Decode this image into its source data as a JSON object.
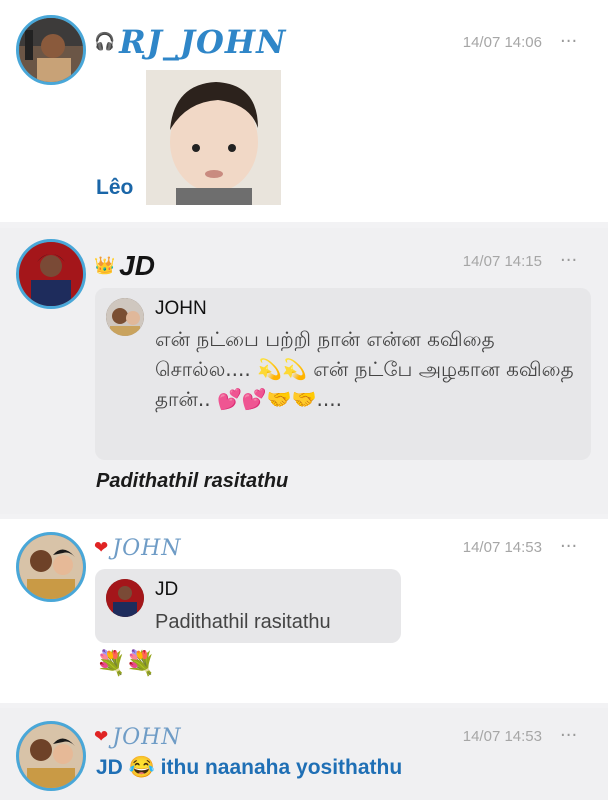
{
  "posts": [
    {
      "username": "RJ_JOHN",
      "badge_icon": "headphones-icon",
      "badge": "🎧",
      "time": "14/07 14:06",
      "more": "···",
      "caption": "Lêo"
    },
    {
      "username": "JD",
      "badge_icon": "crown-icon",
      "badge": "👑",
      "time": "14/07 14:15",
      "more": "···",
      "quote": {
        "name": "JOHN",
        "text": "என் நட்பை பற்றி நான் என்ன கவிதை சொல்ல.... 💫💫 என் நட்பே அழகான கவிதை தான்.. 💕💕🤝🤝...."
      },
      "caption": "Padithathil rasitathu"
    },
    {
      "username": "JOHN",
      "badge_icon": "heart-icon",
      "badge": "❤",
      "time": "14/07 14:53",
      "more": "···",
      "quote": {
        "name": "JD",
        "text": "Padithathil rasitathu"
      },
      "emojis": "💐💐"
    },
    {
      "username": "JOHN",
      "badge_icon": "heart-icon",
      "badge": "❤",
      "time": "14/07 14:53",
      "more": "···",
      "caption": "JD 😂 ithu naanaha yosithathu"
    }
  ],
  "colors": {
    "accent_blue": "#49a7d8",
    "username_blue": "#2f86c8",
    "time_gray": "#a6a6a6"
  }
}
